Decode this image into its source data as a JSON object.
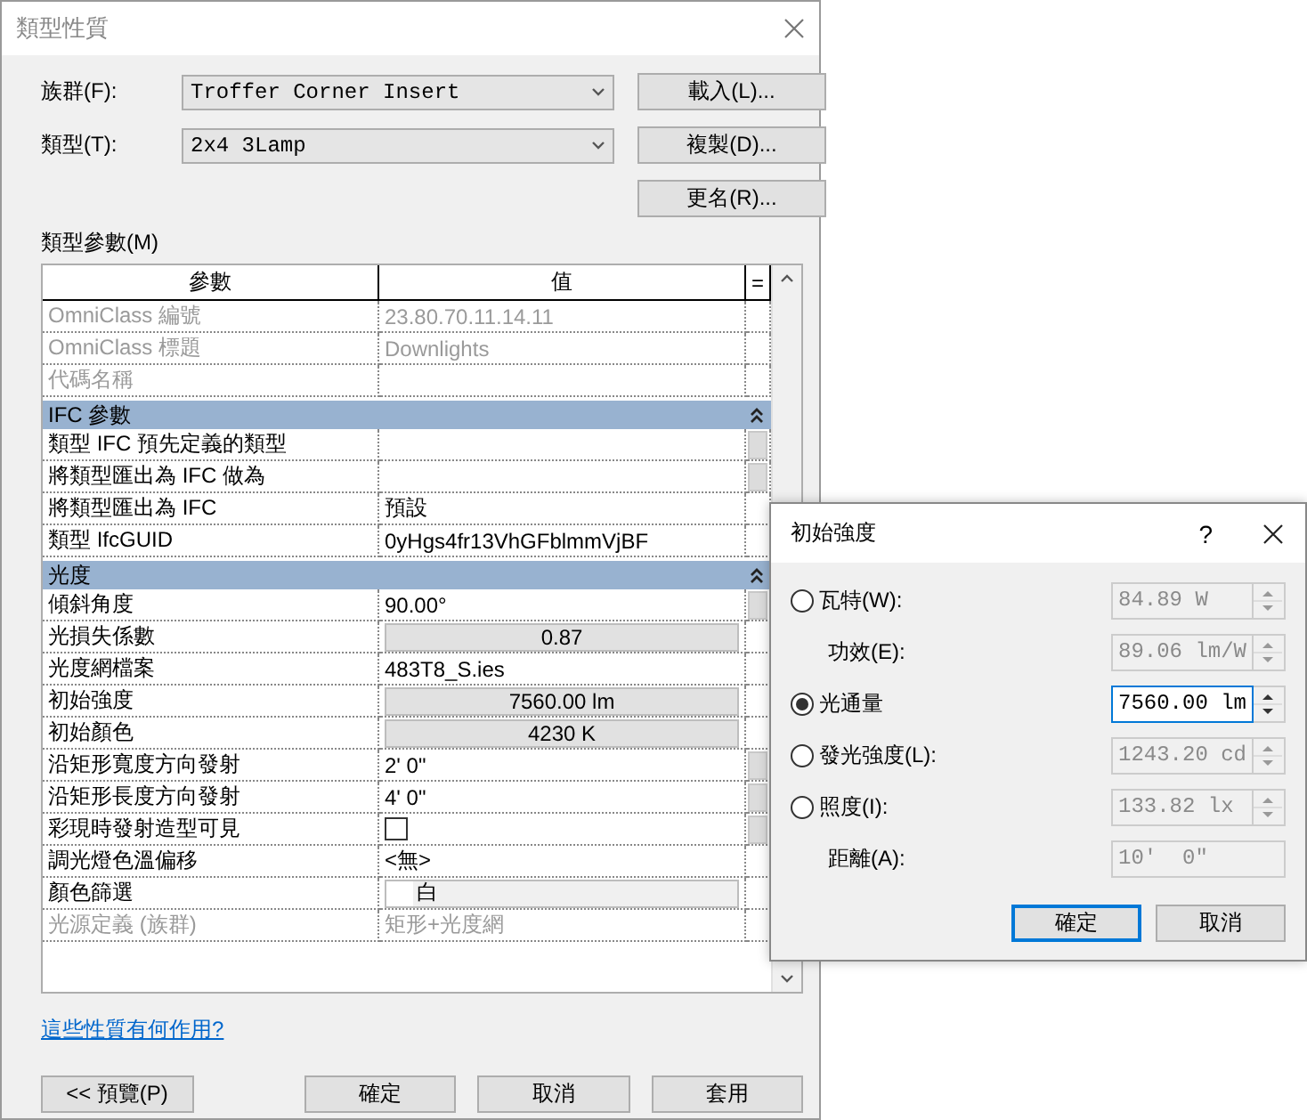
{
  "dialog": {
    "title": "類型性質"
  },
  "family": {
    "label": "族群(F):",
    "value": "Troffer Corner Insert"
  },
  "type": {
    "label": "類型(T):",
    "value": "2x4 3Lamp"
  },
  "side_buttons": [
    "載入(L)...",
    "複製(D)...",
    "更名(R)..."
  ],
  "table_label": "類型參數(M)",
  "columns": [
    "參數",
    "值",
    "="
  ],
  "groups": [
    {
      "rows": [
        {
          "name": "OmniClass 編號",
          "value": "23.80.70.11.14.11",
          "kind": "text",
          "disabled": true,
          "param_button": false
        },
        {
          "name": "OmniClass 標題",
          "value": "Downlights",
          "kind": "text",
          "disabled": true,
          "param_button": false
        },
        {
          "name": "代碼名稱",
          "value": "",
          "kind": "text",
          "disabled": true,
          "param_button": false
        }
      ]
    },
    {
      "title": "IFC 參數",
      "expanded": true,
      "rows": [
        {
          "name": "類型 IFC 預先定義的類型",
          "value": "",
          "kind": "text",
          "disabled": false,
          "param_button": true
        },
        {
          "name": "將類型匯出為 IFC 做為",
          "value": "",
          "kind": "text",
          "disabled": false,
          "param_button": true
        },
        {
          "name": "將類型匯出為 IFC",
          "value": "預設",
          "kind": "text",
          "disabled": false,
          "param_button": false
        },
        {
          "name": "類型 IfcGUID",
          "value": "0yHgs4fr13VhGFblmmVjBF",
          "kind": "text",
          "disabled": false,
          "param_button": false
        }
      ]
    },
    {
      "title": "光度",
      "expanded": true,
      "rows": [
        {
          "name": "傾斜角度",
          "value": "90.00°",
          "kind": "text",
          "disabled": false,
          "param_button": true
        },
        {
          "name": "光損失係數",
          "value": "0.87",
          "kind": "button",
          "disabled": false,
          "param_button": false
        },
        {
          "name": "光度網檔案",
          "value": "483T8_S.ies",
          "kind": "text",
          "disabled": false,
          "param_button": false
        },
        {
          "name": "初始強度",
          "value": "7560.00 lm",
          "kind": "button",
          "disabled": false,
          "param_button": false
        },
        {
          "name": "初始顏色",
          "value": "4230 K",
          "kind": "button",
          "disabled": false,
          "param_button": false
        },
        {
          "name": "沿矩形寬度方向發射",
          "value": "2'  0\"",
          "kind": "text",
          "disabled": false,
          "param_button": true
        },
        {
          "name": "沿矩形長度方向發射",
          "value": "4'  0\"",
          "kind": "text",
          "disabled": false,
          "param_button": true
        },
        {
          "name": "彩現時發射造型可見",
          "value": "",
          "kind": "checkbox",
          "checked": false,
          "disabled": false,
          "param_button": true
        },
        {
          "name": "調光燈色溫偏移",
          "value": "<無>",
          "kind": "text",
          "disabled": false,
          "param_button": false
        },
        {
          "name": "顏色篩選",
          "value": "白",
          "kind": "color",
          "color": "#ffffff",
          "disabled": false,
          "param_button": false
        },
        {
          "name": "光源定義 (族群)",
          "value": "矩形+光度網",
          "kind": "text",
          "disabled": true,
          "param_button": false
        }
      ]
    }
  ],
  "help_link": "這些性質有何作用?",
  "footer_buttons": [
    "<< 預覽(P)",
    "確定",
    "取消",
    "套用"
  ],
  "popup": {
    "title": "初始強度",
    "help": "?",
    "options": [
      {
        "kind": "radio",
        "label": "瓦特(W):",
        "selected": false,
        "value": "84.89 W",
        "spinner": true
      },
      {
        "kind": "sub",
        "label": "功效(E):",
        "value": "89.06 lm/W",
        "spinner": true
      },
      {
        "kind": "radio",
        "label": "光通量",
        "selected": true,
        "value": "7560.00 lm",
        "spinner": true
      },
      {
        "kind": "radio",
        "label": "發光強度(L):",
        "selected": false,
        "value": "1243.20 cd",
        "spinner": true
      },
      {
        "kind": "radio",
        "label": "照度(I):",
        "selected": false,
        "value": "133.82 lx",
        "spinner": true
      },
      {
        "kind": "sub",
        "label": "距離(A):",
        "value": "10'  0\"",
        "spinner": false
      }
    ],
    "buttons": [
      "確定",
      "取消"
    ]
  }
}
